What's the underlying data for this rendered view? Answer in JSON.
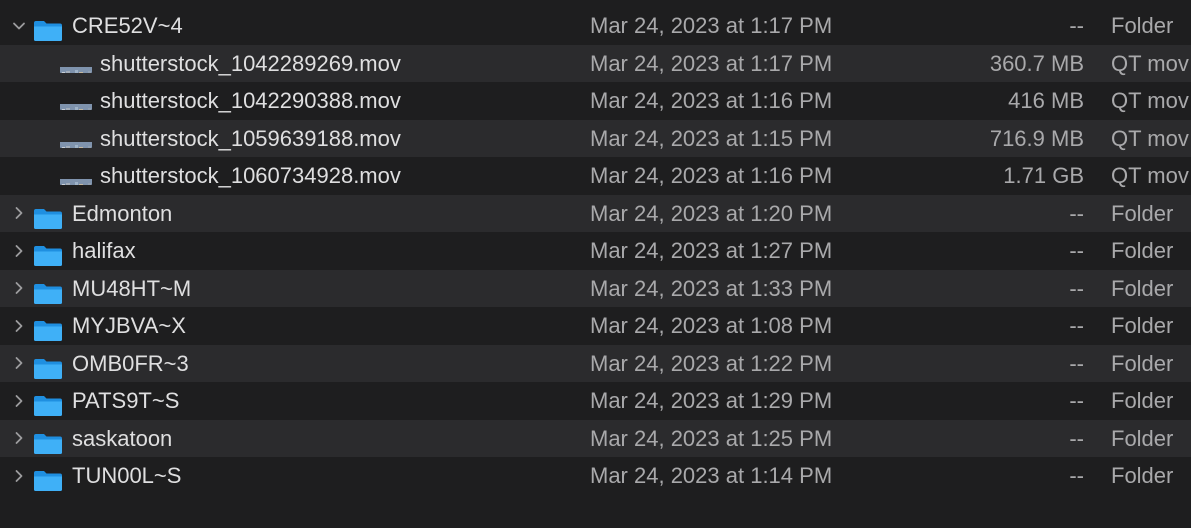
{
  "rows": [
    {
      "name": "CRE52V~4",
      "date": "Mar 24, 2023 at 1:17 PM",
      "size": "--",
      "kind": "Folder",
      "type": "folder",
      "expanded": true
    },
    {
      "name": "shutterstock_1042289269.mov",
      "date": "Mar 24, 2023 at 1:17 PM",
      "size": "360.7 MB",
      "kind": "QT mov",
      "type": "movie"
    },
    {
      "name": "shutterstock_1042290388.mov",
      "date": "Mar 24, 2023 at 1:16 PM",
      "size": "416 MB",
      "kind": "QT mov",
      "type": "movie"
    },
    {
      "name": "shutterstock_1059639188.mov",
      "date": "Mar 24, 2023 at 1:15 PM",
      "size": "716.9 MB",
      "kind": "QT mov",
      "type": "movie"
    },
    {
      "name": "shutterstock_1060734928.mov",
      "date": "Mar 24, 2023 at 1:16 PM",
      "size": "1.71 GB",
      "kind": "QT mov",
      "type": "movie"
    },
    {
      "name": "Edmonton",
      "date": "Mar 24, 2023 at 1:20 PM",
      "size": "--",
      "kind": "Folder",
      "type": "folder",
      "expanded": false
    },
    {
      "name": "halifax",
      "date": "Mar 24, 2023 at 1:27 PM",
      "size": "--",
      "kind": "Folder",
      "type": "folder",
      "expanded": false
    },
    {
      "name": "MU48HT~M",
      "date": "Mar 24, 2023 at 1:33 PM",
      "size": "--",
      "kind": "Folder",
      "type": "folder",
      "expanded": false
    },
    {
      "name": "MYJBVA~X",
      "date": "Mar 24, 2023 at 1:08 PM",
      "size": "--",
      "kind": "Folder",
      "type": "folder",
      "expanded": false
    },
    {
      "name": "OMB0FR~3",
      "date": "Mar 24, 2023 at 1:22 PM",
      "size": "--",
      "kind": "Folder",
      "type": "folder",
      "expanded": false
    },
    {
      "name": "PATS9T~S",
      "date": "Mar 24, 2023 at 1:29 PM",
      "size": "--",
      "kind": "Folder",
      "type": "folder",
      "expanded": false
    },
    {
      "name": "saskatoon",
      "date": "Mar 24, 2023 at 1:25 PM",
      "size": "--",
      "kind": "Folder",
      "type": "folder",
      "expanded": false
    },
    {
      "name": "TUN00L~S",
      "date": "Mar 24, 2023 at 1:14 PM",
      "size": "--",
      "kind": "Folder",
      "type": "folder",
      "expanded": false
    }
  ],
  "colors": {
    "background": "#1e1e1f",
    "row_alt": "#2b2b2d",
    "folder_blue": "#3fa9f5",
    "text": "#dfdfe0",
    "secondary_text": "#a9a9ab"
  }
}
